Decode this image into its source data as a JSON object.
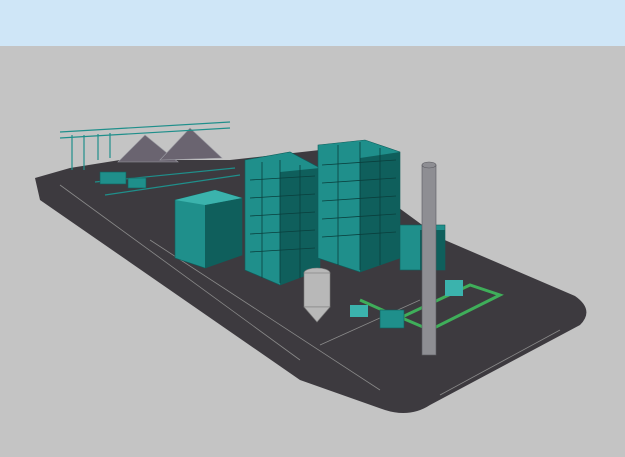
{
  "scene": {
    "colors": {
      "sky": "#cfe6f7",
      "background": "#c4c4c4",
      "pad": "#3d3a3f",
      "pad_line": "#8a8a8a",
      "steel": "#1f8f8b",
      "steel_dark": "#0f5f5c",
      "steel_light": "#3bb3ad",
      "coal_pile": "#6a6470",
      "stack": "#8e8e93",
      "silo": "#b8b8b8",
      "pipe_green": "#3fae5a"
    },
    "icons": [
      "coal-pile-icon",
      "boiler-structure-icon",
      "chimney-stack-icon",
      "silo-icon",
      "conveyor-icon",
      "turbine-hall-icon"
    ]
  }
}
